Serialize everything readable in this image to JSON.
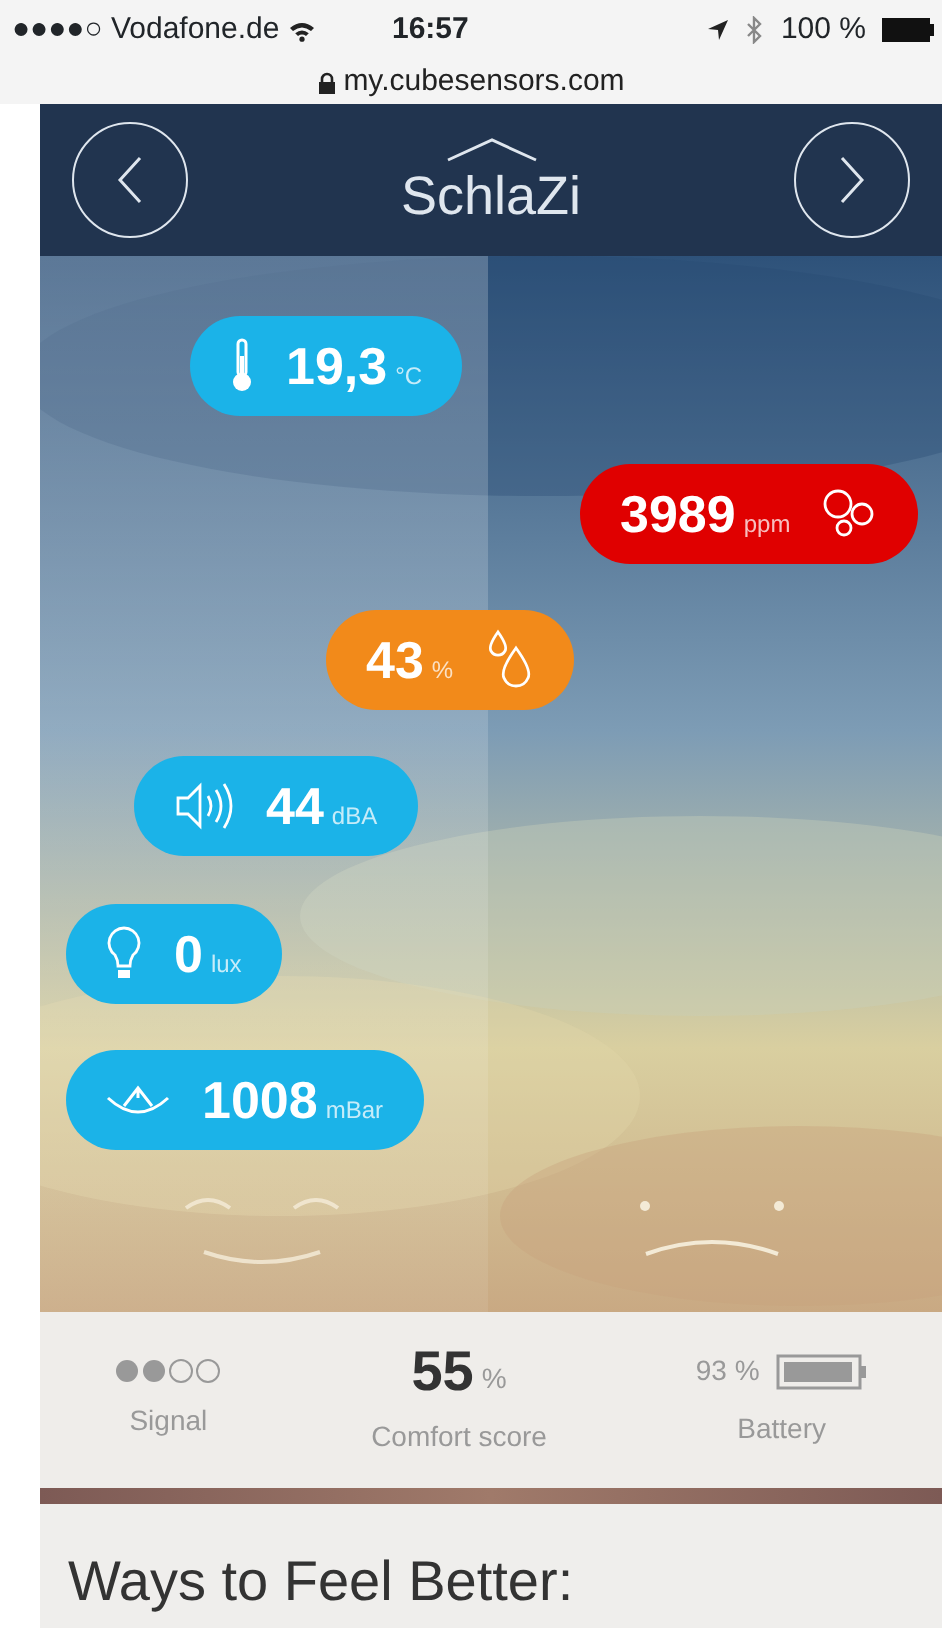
{
  "status_bar": {
    "carrier": "●●●●○ Vodafone.de",
    "time": "16:57",
    "battery": "100 %"
  },
  "url_bar": {
    "url": "my.cubesensors.com"
  },
  "header": {
    "title": "SchlaZi"
  },
  "sensors": [
    {
      "kind": "temperature",
      "value": "19,3",
      "unit": "°C",
      "color": "#1bb3e8"
    },
    {
      "kind": "co2",
      "value": "3989",
      "unit": "ppm",
      "color": "#e00000"
    },
    {
      "kind": "humidity",
      "value": "43",
      "unit": "%",
      "color": "#f28a1a"
    },
    {
      "kind": "noise",
      "value": "44",
      "unit": "dBA",
      "color": "#1bb3e8"
    },
    {
      "kind": "light",
      "value": "0",
      "unit": "lux",
      "color": "#1bb3e8"
    },
    {
      "kind": "pressure",
      "value": "1008",
      "unit": "mBar",
      "color": "#1bb3e8"
    }
  ],
  "stats": {
    "signal_label": "Signal",
    "score": "55",
    "score_unit": "%",
    "score_label": "Comfort score",
    "battery_value": "93 %",
    "battery_label": "Battery"
  },
  "section_title": "Ways to Feel Better:"
}
